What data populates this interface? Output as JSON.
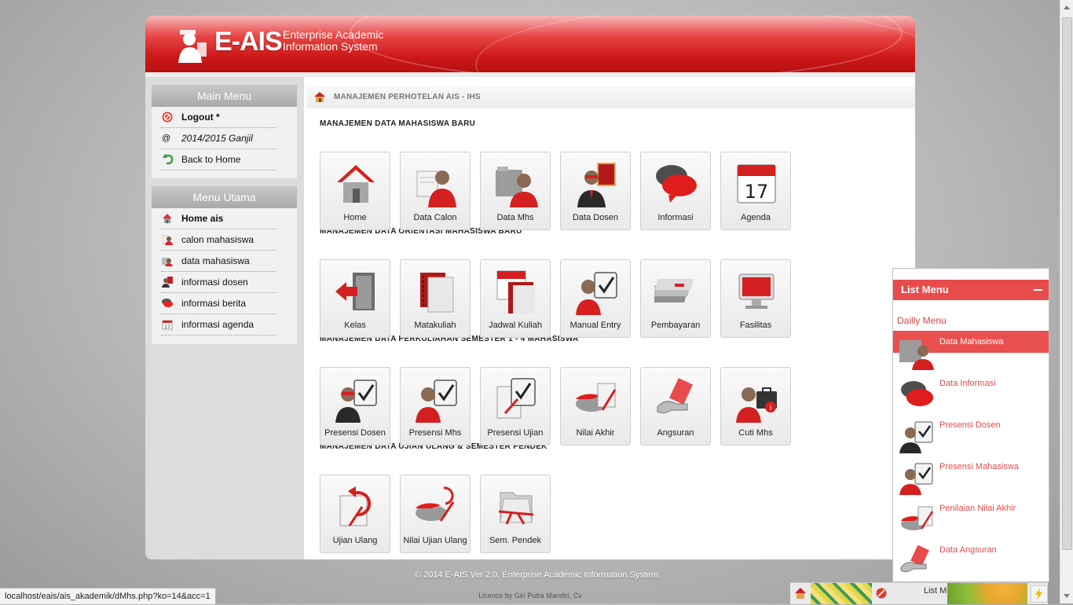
{
  "header": {
    "brand": "E-AIS",
    "tagline_line1": "Enterprise Academic",
    "tagline_line2": "Information System"
  },
  "main_menu": {
    "title": "Main Menu",
    "items": [
      {
        "label": "Logout *",
        "icon": "stop-icon"
      },
      {
        "label": "2014/2015 Ganjil",
        "icon": "at-icon"
      },
      {
        "label": "Back to Home",
        "icon": "back-arrow-icon"
      }
    ]
  },
  "menu_utama": {
    "title": "Menu Utama",
    "items": [
      {
        "label": "Home ais",
        "icon": "home-icon"
      },
      {
        "label": "calon mahasiswa",
        "icon": "user-icon"
      },
      {
        "label": "data mahasiswa",
        "icon": "folder-user-icon"
      },
      {
        "label": "informasi dosen",
        "icon": "teacher-icon"
      },
      {
        "label": "informasi berita",
        "icon": "chat-icon"
      },
      {
        "label": "informasi agenda",
        "icon": "calendar-icon"
      }
    ]
  },
  "breadcrumb": "MANAJEMEN PERHOTELAN AIS - IHS",
  "sections": [
    {
      "title": "MANAJEMEN DATA MAHASISWA BARU",
      "tiles": [
        "Home",
        "Data Calon",
        "Data Mhs",
        "Data Dosen",
        "Informasi",
        "Agenda"
      ]
    },
    {
      "title": "MANAJEMEN DATA ORIENTASI MAHASISWA BARU",
      "tiles": [
        "Kelas",
        "Matakuliah",
        "Jadwal Kuliah",
        "Manual Entry",
        "Pembayaran",
        "Fasilitas"
      ]
    },
    {
      "title": "MANAJEMEN DATA PERKULIAHAN SEMESTER 1 - 4 MAHASISWA",
      "tiles": [
        "Presensi Dosen",
        "Presensi Mhs",
        "Presensi Ujian",
        "Nilai Akhir",
        "Angsuran",
        "Cuti Mhs"
      ]
    },
    {
      "title": "MANAJEMEN DATA UJIAN ULANG & SEMESTER PENDEK",
      "tiles": [
        "Ujian Ulang",
        "Nilai Ujian Ulang",
        "Sem. Pendek"
      ]
    }
  ],
  "footer": {
    "copyright": "© 2014 E-AIS Ver 2.0. Enterprise Academic Information System",
    "licence": "Licence by Giri Putra Mandiri, Cv"
  },
  "status_url": "localhost/eais/ais_akademik/dMhs.php?ko=14&acc=1",
  "list_panel": {
    "title": "List Menu",
    "subtitle": "Dailly Menu",
    "items": [
      "Data Mahasiswa",
      "Data Informasi",
      "Presensi Dosen",
      "Presensi Mahasiswa",
      "Penilaian Nilai Akhir",
      "Data Angsuran"
    ],
    "active_index": 0
  },
  "taskbar": {
    "list_label": "List Menu"
  },
  "colors": {
    "header_red": "#d42020",
    "panel_red": "#e84b4b",
    "sidebar_gray": "#dcdcdc"
  }
}
